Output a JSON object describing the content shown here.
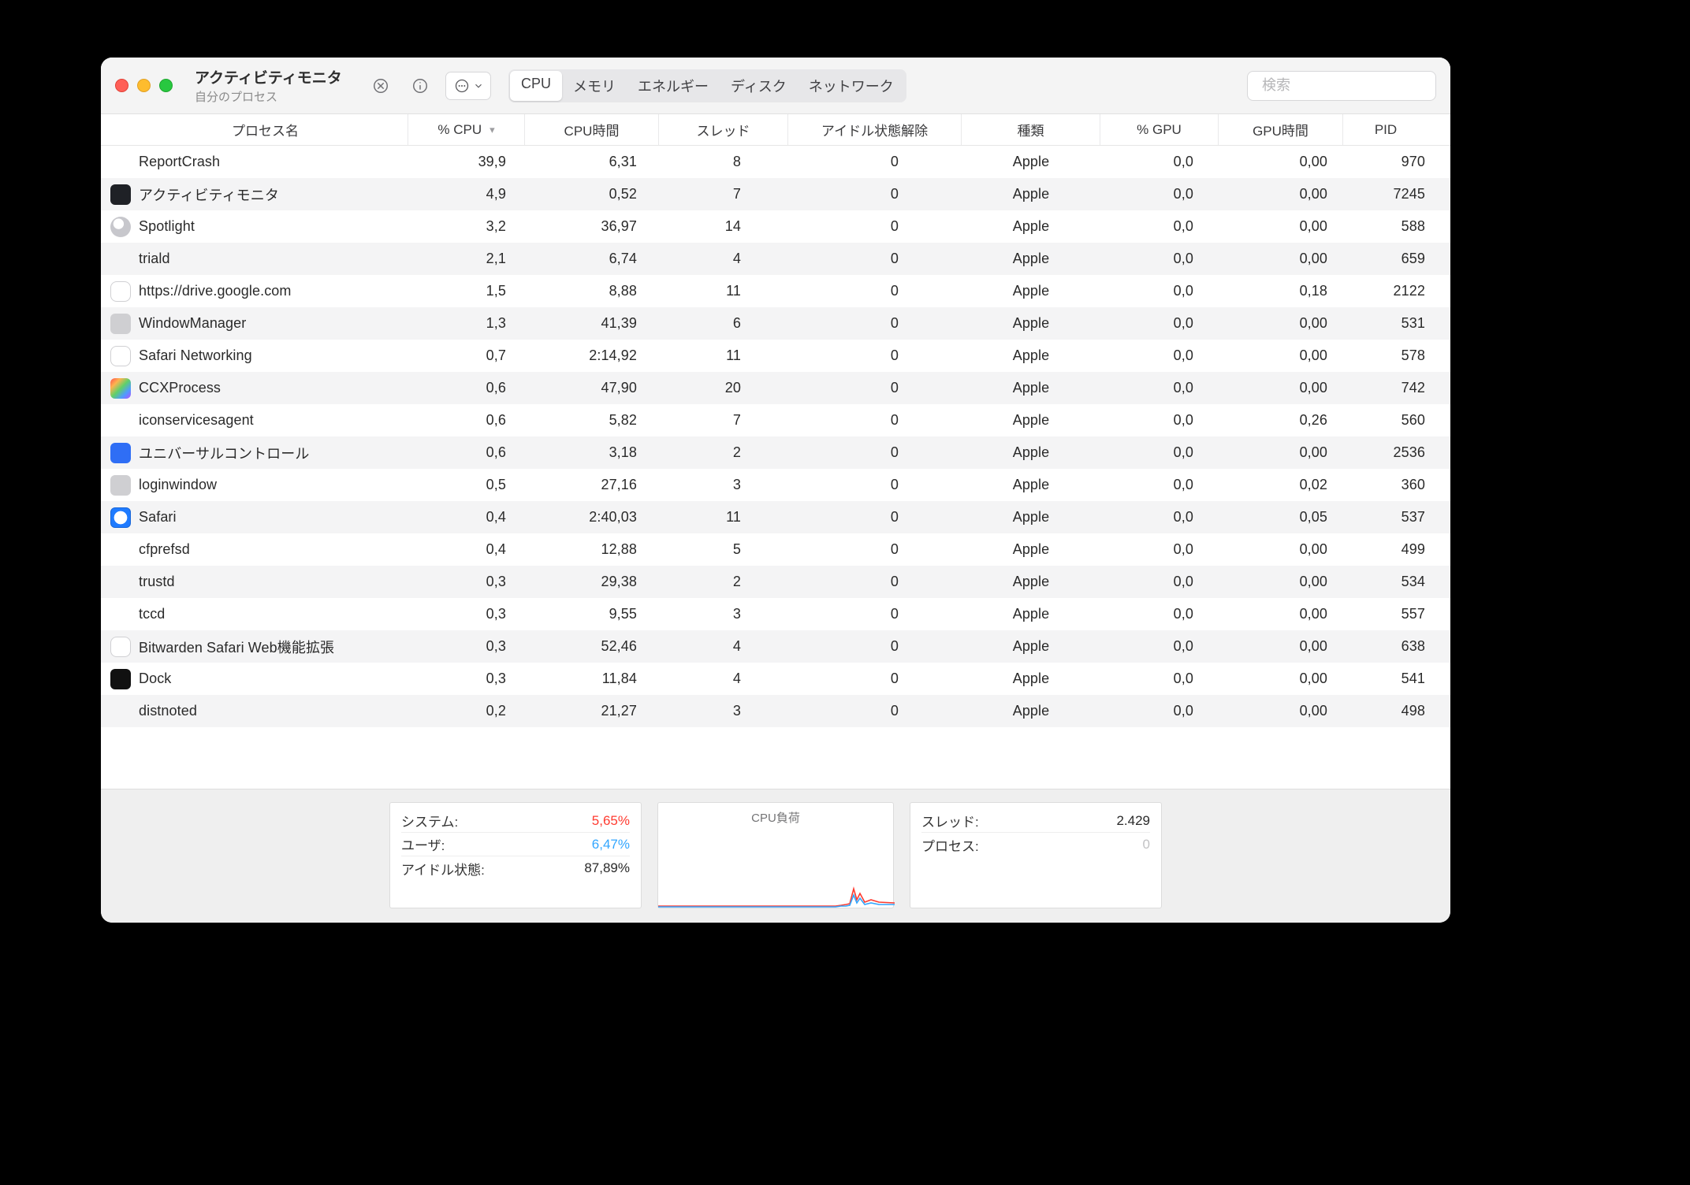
{
  "window": {
    "title": "アクティビティモニタ",
    "subtitle": "自分のプロセス"
  },
  "toolbar": {
    "tabs": [
      "CPU",
      "メモリ",
      "エネルギー",
      "ディスク",
      "ネットワーク"
    ],
    "active_tab": 0,
    "search_placeholder": "検索"
  },
  "columns": {
    "name": "プロセス名",
    "pcpu": "% CPU",
    "ctime": "CPU時間",
    "thr": "スレッド",
    "idle": "アイドル状態解除",
    "kind": "種類",
    "pgpu": "% GPU",
    "gtime": "GPU時間",
    "pid": "PID"
  },
  "sort": {
    "column": "pcpu",
    "dir": "desc"
  },
  "rows": [
    {
      "icon": "none",
      "name": "ReportCrash",
      "pcpu": "39,9",
      "ctime": "6,31",
      "thr": "8",
      "idle": "0",
      "kind": "Apple",
      "pgpu": "0,0",
      "gtime": "0,00",
      "pid": "970"
    },
    {
      "icon": "dark",
      "name": "アクティビティモニタ",
      "pcpu": "4,9",
      "ctime": "0,52",
      "thr": "7",
      "idle": "0",
      "kind": "Apple",
      "pgpu": "0,0",
      "gtime": "0,00",
      "pid": "7245"
    },
    {
      "icon": "glass",
      "name": "Spotlight",
      "pcpu": "3,2",
      "ctime": "36,97",
      "thr": "14",
      "idle": "0",
      "kind": "Apple",
      "pgpu": "0,0",
      "gtime": "0,00",
      "pid": "588"
    },
    {
      "icon": "none",
      "name": "triald",
      "pcpu": "2,1",
      "ctime": "6,74",
      "thr": "4",
      "idle": "0",
      "kind": "Apple",
      "pgpu": "0,0",
      "gtime": "0,00",
      "pid": "659"
    },
    {
      "icon": "white",
      "name": "https://drive.google.com",
      "pcpu": "1,5",
      "ctime": "8,88",
      "thr": "11",
      "idle": "0",
      "kind": "Apple",
      "pgpu": "0,0",
      "gtime": "0,18",
      "pid": "2122"
    },
    {
      "icon": "gray",
      "name": "WindowManager",
      "pcpu": "1,3",
      "ctime": "41,39",
      "thr": "6",
      "idle": "0",
      "kind": "Apple",
      "pgpu": "0,0",
      "gtime": "0,00",
      "pid": "531"
    },
    {
      "icon": "white",
      "name": "Safari Networking",
      "pcpu": "0,7",
      "ctime": "2:14,92",
      "thr": "11",
      "idle": "0",
      "kind": "Apple",
      "pgpu": "0,0",
      "gtime": "0,00",
      "pid": "578"
    },
    {
      "icon": "rainbow",
      "name": "CCXProcess",
      "pcpu": "0,6",
      "ctime": "47,90",
      "thr": "20",
      "idle": "0",
      "kind": "Apple",
      "pgpu": "0,0",
      "gtime": "0,00",
      "pid": "742"
    },
    {
      "icon": "none",
      "name": "iconservicesagent",
      "pcpu": "0,6",
      "ctime": "5,82",
      "thr": "7",
      "idle": "0",
      "kind": "Apple",
      "pgpu": "0,0",
      "gtime": "0,26",
      "pid": "560"
    },
    {
      "icon": "blue",
      "name": "ユニバーサルコントロール",
      "pcpu": "0,6",
      "ctime": "3,18",
      "thr": "2",
      "idle": "0",
      "kind": "Apple",
      "pgpu": "0,0",
      "gtime": "0,00",
      "pid": "2536"
    },
    {
      "icon": "gray",
      "name": "loginwindow",
      "pcpu": "0,5",
      "ctime": "27,16",
      "thr": "3",
      "idle": "0",
      "kind": "Apple",
      "pgpu": "0,0",
      "gtime": "0,02",
      "pid": "360"
    },
    {
      "icon": "safari",
      "name": "Safari",
      "pcpu": "0,4",
      "ctime": "2:40,03",
      "thr": "11",
      "idle": "0",
      "kind": "Apple",
      "pgpu": "0,0",
      "gtime": "0,05",
      "pid": "537"
    },
    {
      "icon": "none",
      "name": "cfprefsd",
      "pcpu": "0,4",
      "ctime": "12,88",
      "thr": "5",
      "idle": "0",
      "kind": "Apple",
      "pgpu": "0,0",
      "gtime": "0,00",
      "pid": "499"
    },
    {
      "icon": "none",
      "name": "trustd",
      "pcpu": "0,3",
      "ctime": "29,38",
      "thr": "2",
      "idle": "0",
      "kind": "Apple",
      "pgpu": "0,0",
      "gtime": "0,00",
      "pid": "534"
    },
    {
      "icon": "none",
      "name": "tccd",
      "pcpu": "0,3",
      "ctime": "9,55",
      "thr": "3",
      "idle": "0",
      "kind": "Apple",
      "pgpu": "0,0",
      "gtime": "0,00",
      "pid": "557"
    },
    {
      "icon": "white",
      "name": "Bitwarden Safari Web機能拡張",
      "pcpu": "0,3",
      "ctime": "52,46",
      "thr": "4",
      "idle": "0",
      "kind": "Apple",
      "pgpu": "0,0",
      "gtime": "0,00",
      "pid": "638"
    },
    {
      "icon": "black",
      "name": "Dock",
      "pcpu": "0,3",
      "ctime": "11,84",
      "thr": "4",
      "idle": "0",
      "kind": "Apple",
      "pgpu": "0,0",
      "gtime": "0,00",
      "pid": "541"
    },
    {
      "icon": "none",
      "name": "distnoted",
      "pcpu": "0,2",
      "ctime": "21,27",
      "thr": "3",
      "idle": "0",
      "kind": "Apple",
      "pgpu": "0,0",
      "gtime": "0,00",
      "pid": "498"
    }
  ],
  "footer": {
    "left": {
      "system_label": "システム:",
      "system_value": "5,65%",
      "user_label": "ユーザ:",
      "user_value": "6,47%",
      "idle_label": "アイドル状態:",
      "idle_value": "87,89%"
    },
    "chart_title": "CPU負荷",
    "right": {
      "threads_label": "スレッド:",
      "threads_value": "2.429",
      "procs_label": "プロセス:",
      "procs_value": "0"
    }
  }
}
